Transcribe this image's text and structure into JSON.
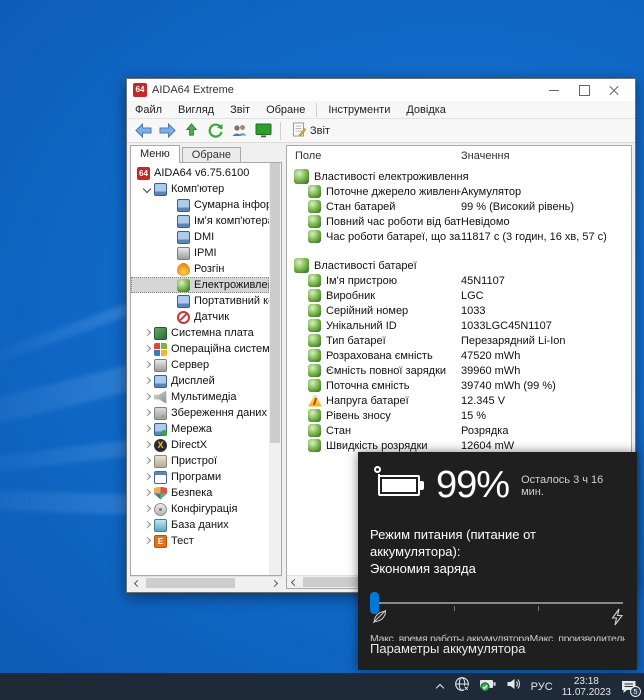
{
  "window": {
    "title": "AIDA64 Extreme",
    "logo_text": "64",
    "menu_groups": [
      [
        "Файл",
        "Вигляд",
        "Звіт",
        "Обране"
      ],
      [
        "Інструменти",
        "Довідка"
      ]
    ],
    "toolbar": {
      "report_label": "Звіт"
    }
  },
  "sidebar": {
    "tabs": [
      "Меню",
      "Обране"
    ],
    "active_tab": "Меню",
    "root": {
      "label": "AIDA64 v6.75.6100",
      "icon": "aida-logo-icon"
    },
    "tree": [
      {
        "label": "Комп'ютер",
        "icon": "computer-icon",
        "expanded": true,
        "children": [
          {
            "label": "Сумарна інформація",
            "icon": "summary-icon"
          },
          {
            "label": "Ім'я комп'ютера",
            "icon": "computer-name-icon"
          },
          {
            "label": "DMI",
            "icon": "dmi-icon"
          },
          {
            "label": "IPMI",
            "icon": "ipmi-icon"
          },
          {
            "label": "Розгін",
            "icon": "overclock-icon"
          },
          {
            "label": "Електроживлення",
            "icon": "power-icon",
            "selected": true
          },
          {
            "label": "Портативний комп'ют",
            "icon": "portable-icon"
          },
          {
            "label": "Датчик",
            "icon": "sensor-icon"
          }
        ]
      },
      {
        "label": "Системна плата",
        "icon": "motherboard-icon"
      },
      {
        "label": "Операційна система",
        "icon": "os-icon"
      },
      {
        "label": "Сервер",
        "icon": "server-icon"
      },
      {
        "label": "Дисплей",
        "icon": "display-icon"
      },
      {
        "label": "Мультимедіа",
        "icon": "multimedia-icon"
      },
      {
        "label": "Збереження даних",
        "icon": "storage-icon"
      },
      {
        "label": "Мережа",
        "icon": "network-icon"
      },
      {
        "label": "DirectX",
        "icon": "directx-icon"
      },
      {
        "label": "Пристрої",
        "icon": "devices-icon"
      },
      {
        "label": "Програми",
        "icon": "programs-icon"
      },
      {
        "label": "Безпека",
        "icon": "security-icon"
      },
      {
        "label": "Конфігурація",
        "icon": "config-icon"
      },
      {
        "label": "База даних",
        "icon": "database-icon"
      },
      {
        "label": "Тест",
        "icon": "benchmark-icon"
      }
    ]
  },
  "main": {
    "columns": [
      "Поле",
      "Значення"
    ],
    "sections": [
      {
        "title": "Властивості електроживлення",
        "rows": [
          {
            "field": "Поточне джерело живлення",
            "value": "Акумулятор"
          },
          {
            "field": "Стан батарей",
            "value": "99 % (Високий рівень)"
          },
          {
            "field": "Повний час роботи від батареї",
            "value": "Невідомо"
          },
          {
            "field": "Час роботи батареї, що залиш...",
            "value": "11817 с (3 годин, 16 хв, 57 с)"
          }
        ]
      },
      {
        "title": "Властивості батареї",
        "rows": [
          {
            "field": "Ім'я пристрою",
            "value": "45N1107"
          },
          {
            "field": "Виробник",
            "value": "LGC"
          },
          {
            "field": "Серійний номер",
            "value": "1033"
          },
          {
            "field": "Унікальний ID",
            "value": "1033LGC45N1107"
          },
          {
            "field": "Тип батареї",
            "value": "Перезарядний Li-Ion"
          },
          {
            "field": "Розрахована ємність",
            "value": "47520 mWh"
          },
          {
            "field": "Ємність повної зарядки",
            "value": "39960 mWh"
          },
          {
            "field": "Поточна ємність",
            "value": "39740 mWh  (99 %)"
          },
          {
            "field": "Напруга батареї",
            "value": "12.345 V",
            "warning": true
          },
          {
            "field": "Рівень зносу",
            "value": "15 %"
          },
          {
            "field": "Стан",
            "value": "Розрядка"
          },
          {
            "field": "Швидкість розрядки",
            "value": "12604 mW"
          }
        ]
      }
    ]
  },
  "flyout": {
    "percent": "99%",
    "remaining": "Осталось 3 ч 16 мин.",
    "mode_label": "Режим питания (питание от аккумулятора):",
    "mode_value": "Экономия заряда",
    "slider_left": "Макс. время работы аккумулятора",
    "slider_right": "Макс. производительность",
    "settings_link": "Параметры аккумулятора",
    "accent_color": "#0078d7"
  },
  "taskbar": {
    "lang": "РУС",
    "time": "23:18",
    "date": "11.07.2023",
    "notification_count": "5"
  }
}
